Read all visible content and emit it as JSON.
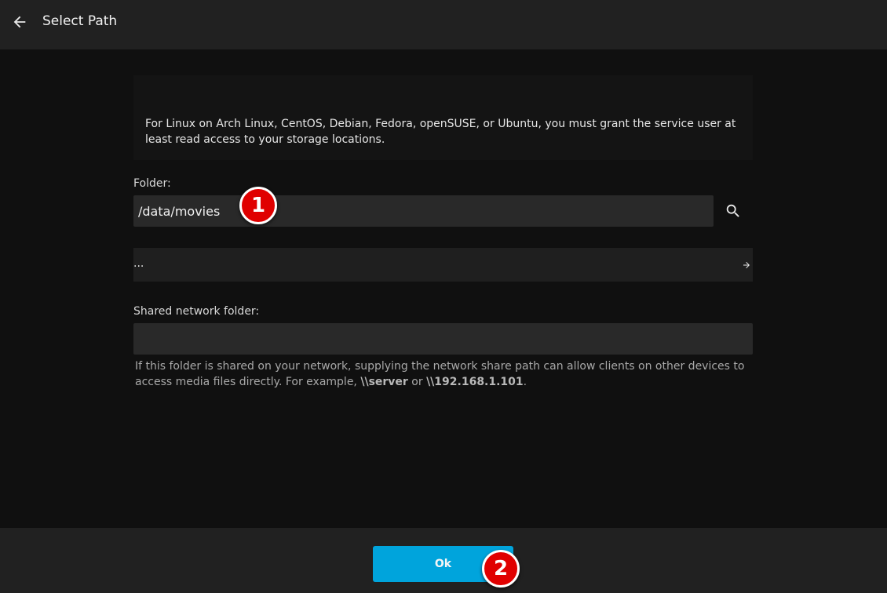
{
  "header": {
    "title": "Select Path",
    "back_icon": "arrow-back-icon"
  },
  "info": {
    "text": "For Linux on Arch Linux, CentOS, Debian, Fedora, openSUSE, or Ubuntu, you must grant the service user at least read access to your storage locations."
  },
  "folder": {
    "label": "Folder:",
    "value": "/data/movies",
    "search_icon": "search-icon"
  },
  "directory_list": {
    "items": [
      {
        "name": "...",
        "icon": "arrow-forward-icon"
      }
    ]
  },
  "network_share": {
    "label": "Shared network folder:",
    "value": "",
    "help_prefix": "If this folder is shared on your network, supplying the network share path can allow clients on other devices to access media files directly. For example, ",
    "example_1": "\\\\server",
    "help_middle": " or ",
    "example_2": "\\\\192.168.1.101",
    "help_suffix": "."
  },
  "footer": {
    "ok_label": "Ok"
  },
  "annotations": {
    "marker_1": "1",
    "marker_2": "2"
  },
  "colors": {
    "accent": "#00a4dc",
    "header_bg": "#212121",
    "page_bg": "#101010",
    "input_bg": "#292929",
    "marker": "#e00000"
  }
}
